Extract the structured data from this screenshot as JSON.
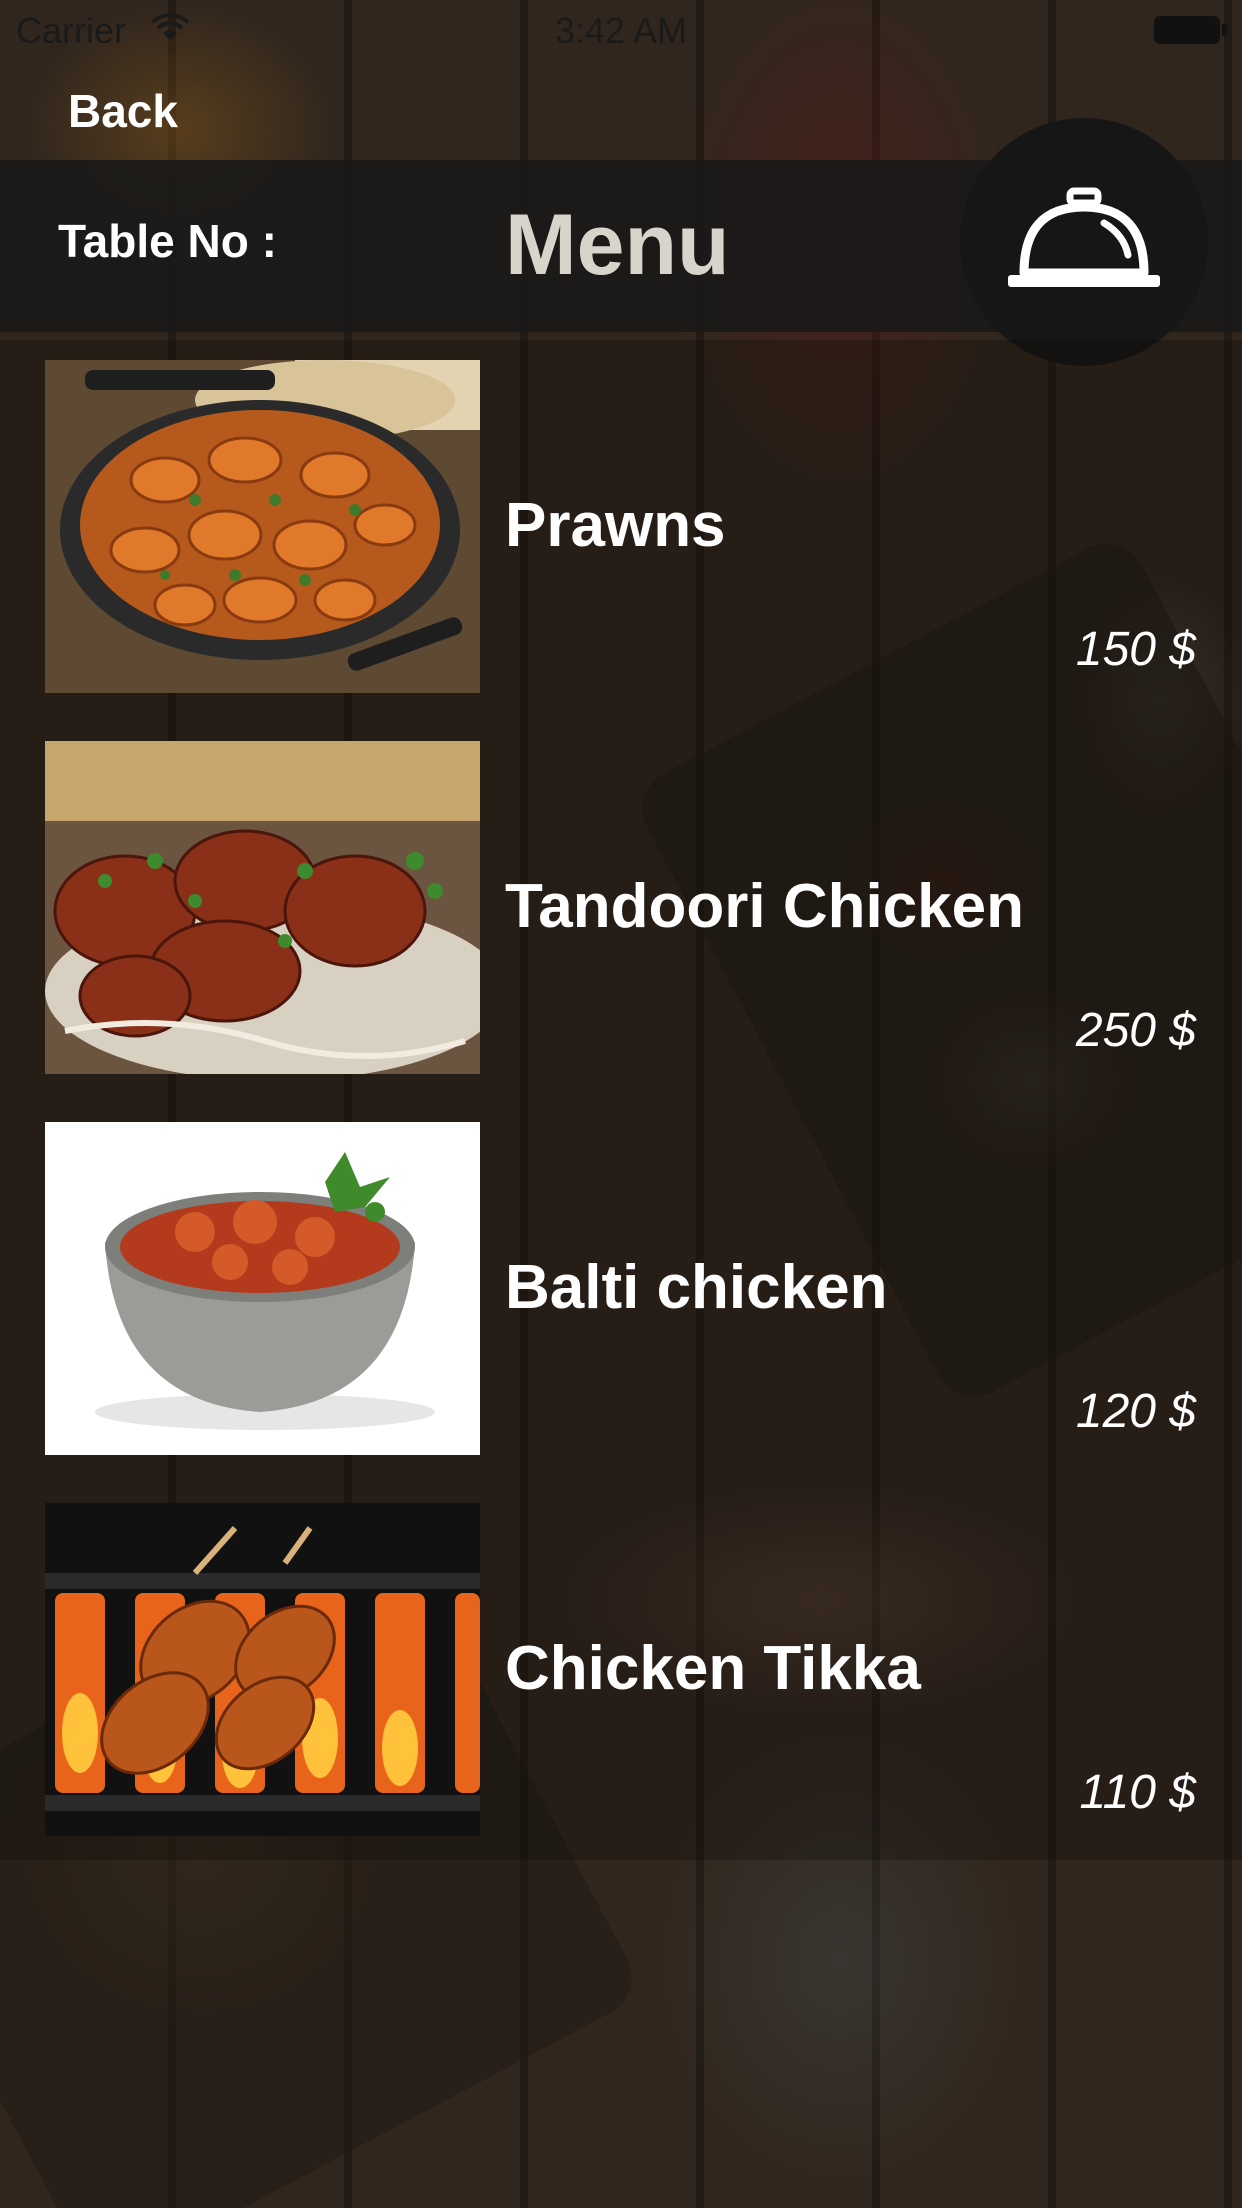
{
  "status_bar": {
    "carrier": "Carrier",
    "time": "3:42 AM"
  },
  "nav": {
    "back_label": "Back"
  },
  "header": {
    "table_label": "Table No :",
    "title": "Menu",
    "order_icon": "cloche-icon"
  },
  "menu": {
    "items": [
      {
        "name": "Prawns",
        "price": "150  $",
        "image": "prawns-dish-photo"
      },
      {
        "name": "Tandoori Chicken",
        "price": "250  $",
        "image": "tandoori-chicken-photo"
      },
      {
        "name": "Balti chicken",
        "price": "120  $",
        "image": "balti-chicken-photo"
      },
      {
        "name": "Chicken Tikka",
        "price": "110  $",
        "image": "chicken-tikka-photo"
      }
    ]
  }
}
